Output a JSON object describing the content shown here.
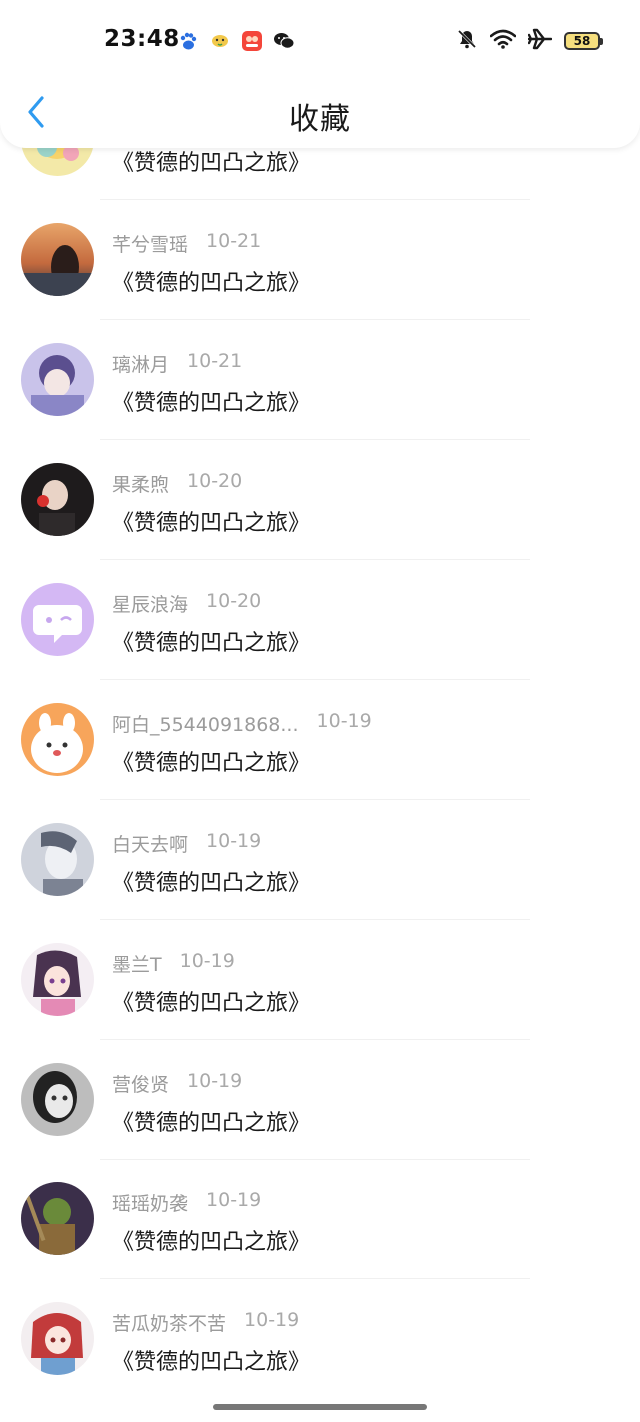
{
  "status_bar": {
    "time": "23:48",
    "battery": "58",
    "notification_icons": [
      "baidu-icon",
      "bird-app-icon",
      "red-app-icon",
      "wechat-icon"
    ],
    "system_icons": [
      "mute-icon",
      "wifi-icon",
      "airplane-icon",
      "battery-icon"
    ]
  },
  "header": {
    "title": "收藏",
    "back_icon": "chevron-left-icon"
  },
  "items": [
    {
      "user": "",
      "date": "",
      "title": "《赞德的凹凸之旅》"
    },
    {
      "user": "芊兮雪瑶",
      "date": "10-21",
      "title": "《赞德的凹凸之旅》"
    },
    {
      "user": "璃淋月",
      "date": "10-21",
      "title": "《赞德的凹凸之旅》"
    },
    {
      "user": "果柔煦",
      "date": "10-20",
      "title": "《赞德的凹凸之旅》"
    },
    {
      "user": "星辰浪海",
      "date": "10-20",
      "title": "《赞德的凹凸之旅》"
    },
    {
      "user": "阿白_5544091868...",
      "date": "10-19",
      "title": "《赞德的凹凸之旅》"
    },
    {
      "user": "白天去啊",
      "date": "10-19",
      "title": "《赞德的凹凸之旅》"
    },
    {
      "user": "墨兰T",
      "date": "10-19",
      "title": "《赞德的凹凸之旅》"
    },
    {
      "user": "营俊贤",
      "date": "10-19",
      "title": "《赞德的凹凸之旅》"
    },
    {
      "user": "瑶瑶奶袭",
      "date": "10-19",
      "title": "《赞德的凹凸之旅》"
    },
    {
      "user": "苦瓜奶茶不苦",
      "date": "10-19",
      "title": "《赞德的凹凸之旅》"
    }
  ],
  "colors": {
    "accent": "#2f9bf0",
    "meta_text": "#9b9b9b",
    "title_text": "#1a1a1a"
  }
}
